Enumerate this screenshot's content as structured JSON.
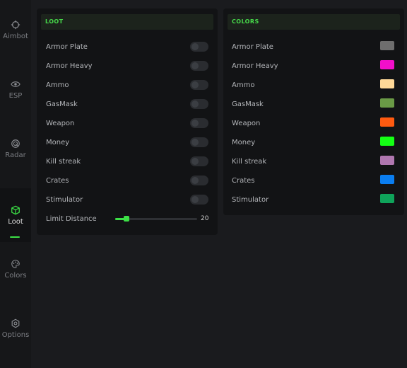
{
  "sidebar": {
    "items": [
      {
        "label": "Aimbot",
        "icon": "target-icon"
      },
      {
        "label": "ESP",
        "icon": "eye-icon"
      },
      {
        "label": "Radar",
        "icon": "radar-icon"
      },
      {
        "label": "Loot",
        "icon": "cube-icon",
        "active": true
      },
      {
        "label": "Colors",
        "icon": "palette-icon"
      },
      {
        "label": "Options",
        "icon": "gear-icon"
      }
    ]
  },
  "loot_panel": {
    "title": "LOOT",
    "toggles": [
      {
        "label": "Armor Plate",
        "on": false
      },
      {
        "label": "Armor Heavy",
        "on": false
      },
      {
        "label": "Ammo",
        "on": false
      },
      {
        "label": "GasMask",
        "on": false
      },
      {
        "label": "Weapon",
        "on": false
      },
      {
        "label": "Money",
        "on": false
      },
      {
        "label": "Kill streak",
        "on": false
      },
      {
        "label": "Crates",
        "on": false
      },
      {
        "label": "Stimulator",
        "on": false
      }
    ],
    "limit_distance": {
      "label": "Limit Distance",
      "value": "20",
      "fraction": 0.14
    }
  },
  "colors_panel": {
    "title": "COLORS",
    "items": [
      {
        "label": "Armor Plate",
        "color": "#6e6e6e"
      },
      {
        "label": "Armor Heavy",
        "color": "#f20fca"
      },
      {
        "label": "Ammo",
        "color": "#ffd998"
      },
      {
        "label": "GasMask",
        "color": "#6a9a46"
      },
      {
        "label": "Weapon",
        "color": "#ff5a10"
      },
      {
        "label": "Money",
        "color": "#14ff14"
      },
      {
        "label": "Kill streak",
        "color": "#b077b0"
      },
      {
        "label": "Crates",
        "color": "#0a7df0"
      },
      {
        "label": "Stimulator",
        "color": "#0fa35a"
      }
    ]
  },
  "theme": {
    "accent": "#3ce046",
    "background": "#1a1b1e"
  }
}
